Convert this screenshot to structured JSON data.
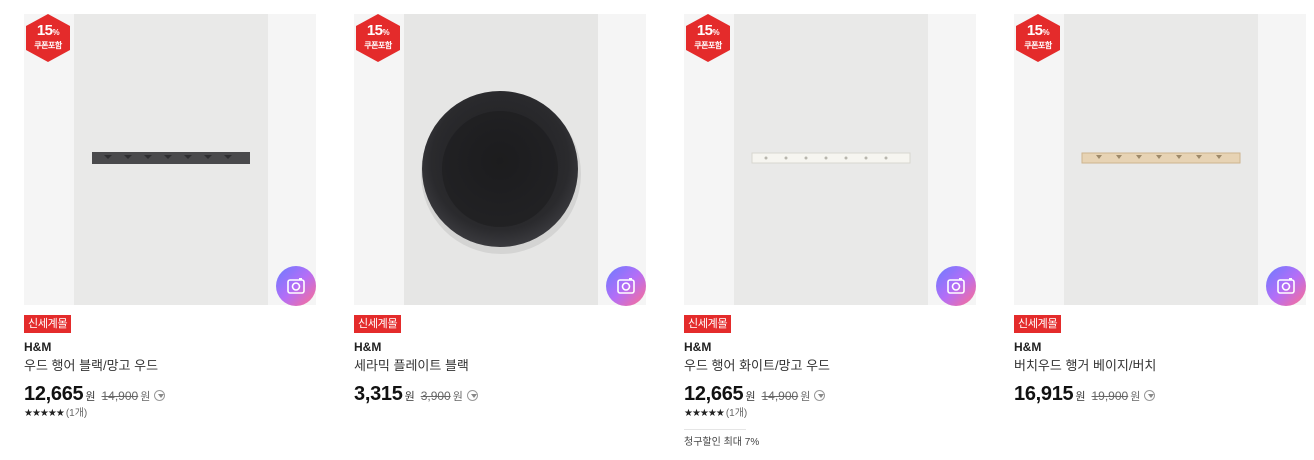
{
  "colors": {
    "badge_red": "#e42b2b",
    "tag_red": "#e42b2b"
  },
  "products": [
    {
      "badge": {
        "percent": "15",
        "percent_sign": "%",
        "coupon": "쿠폰포함"
      },
      "tag": "신세계몰",
      "brand": "H&M",
      "name": "우드 행어 블랙/망고 우드",
      "price": "12,665",
      "won": "원",
      "original_price": "14,900",
      "won_orig": "원",
      "stars": "★★★★★",
      "review_count": "(1개)",
      "image": "black wall hanger rail"
    },
    {
      "badge": {
        "percent": "15",
        "percent_sign": "%",
        "coupon": "쿠폰포함"
      },
      "tag": "신세계몰",
      "brand": "H&M",
      "name": "세라믹 플레이트 블랙",
      "price": "3,315",
      "won": "원",
      "original_price": "3,900",
      "won_orig": "원",
      "image": "black ceramic plate"
    },
    {
      "badge": {
        "percent": "15",
        "percent_sign": "%",
        "coupon": "쿠폰포함"
      },
      "tag": "신세계몰",
      "brand": "H&M",
      "name": "우드 행어 화이트/망고 우드",
      "price": "12,665",
      "won": "원",
      "original_price": "14,900",
      "won_orig": "원",
      "stars": "★★★★★",
      "review_count": "(1개)",
      "billing_discount": "청구할인 최대 7%",
      "image": "white wall hanger rail"
    },
    {
      "badge": {
        "percent": "15",
        "percent_sign": "%",
        "coupon": "쿠폰포함"
      },
      "tag": "신세계몰",
      "brand": "H&M",
      "name": "버치우드 행거 베이지/버치",
      "price": "16,915",
      "won": "원",
      "original_price": "19,900",
      "won_orig": "원",
      "image": "beige birch wall hanger"
    }
  ]
}
